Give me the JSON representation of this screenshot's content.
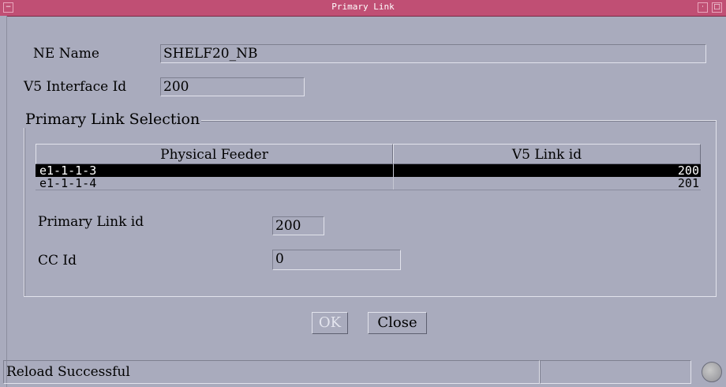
{
  "window": {
    "title": "Primary Link"
  },
  "ne": {
    "label": "NE Name",
    "value": "SHELF20_NB"
  },
  "v5": {
    "label": "V5 Interface Id",
    "value": "200"
  },
  "group": {
    "title": "Primary Link Selection"
  },
  "table": {
    "headers": [
      "Physical Feeder",
      "V5 Link id"
    ],
    "rows": [
      {
        "feeder": "e1-1-1-3",
        "link_id": "200",
        "selected": true
      },
      {
        "feeder": "e1-1-1-4",
        "link_id": "201",
        "selected": false
      }
    ]
  },
  "primary_link": {
    "label": "Primary Link id",
    "value": "200"
  },
  "cc": {
    "label": "CC Id",
    "value": "0"
  },
  "buttons": {
    "ok": "OK",
    "close": "Close"
  },
  "status": {
    "message": "Reload Successful",
    "secondary": ""
  },
  "icons": {
    "menu": "window-menu-icon",
    "minimize": "minimize-icon",
    "maximize": "maximize-icon",
    "status": "status-light-icon"
  },
  "colors": {
    "titlebar": "#c04f74",
    "background": "#a9abbd",
    "selection": "#000000"
  }
}
